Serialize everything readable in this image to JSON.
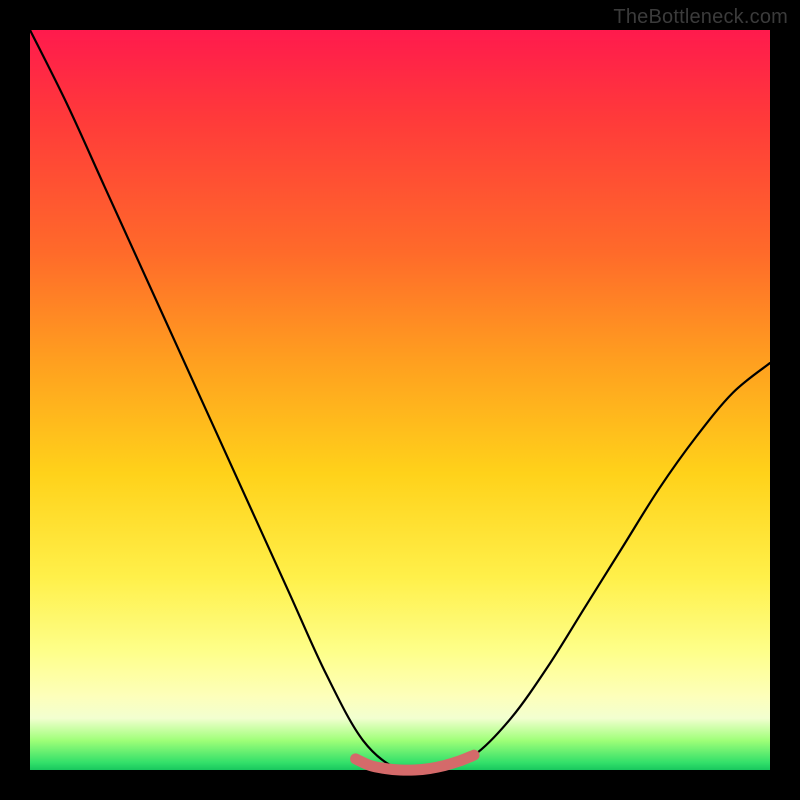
{
  "watermark": "TheBottleneck.com",
  "chart_data": {
    "type": "line",
    "title": "",
    "xlabel": "",
    "ylabel": "",
    "xlim": [
      0,
      1
    ],
    "ylim": [
      0,
      1
    ],
    "series": [
      {
        "name": "bottleneck-curve",
        "x": [
          0.0,
          0.05,
          0.1,
          0.15,
          0.2,
          0.25,
          0.3,
          0.35,
          0.4,
          0.45,
          0.5,
          0.55,
          0.6,
          0.65,
          0.7,
          0.75,
          0.8,
          0.85,
          0.9,
          0.95,
          1.0
        ],
        "y": [
          1.0,
          0.9,
          0.79,
          0.68,
          0.57,
          0.46,
          0.35,
          0.24,
          0.13,
          0.04,
          0.0,
          0.0,
          0.02,
          0.07,
          0.14,
          0.22,
          0.3,
          0.38,
          0.45,
          0.51,
          0.55
        ]
      },
      {
        "name": "flat-zone-marker",
        "x": [
          0.44,
          0.46,
          0.48,
          0.5,
          0.52,
          0.54,
          0.56,
          0.58,
          0.6
        ],
        "y": [
          0.015,
          0.006,
          0.002,
          0.0,
          0.0,
          0.002,
          0.006,
          0.012,
          0.02
        ]
      }
    ],
    "annotations": [],
    "colors": {
      "curve": "#000000",
      "flat_zone_marker": "#d46a6a",
      "gradient_top": "#ff1a4d",
      "gradient_mid": "#ffd21a",
      "gradient_bottom": "#18c75e"
    }
  }
}
